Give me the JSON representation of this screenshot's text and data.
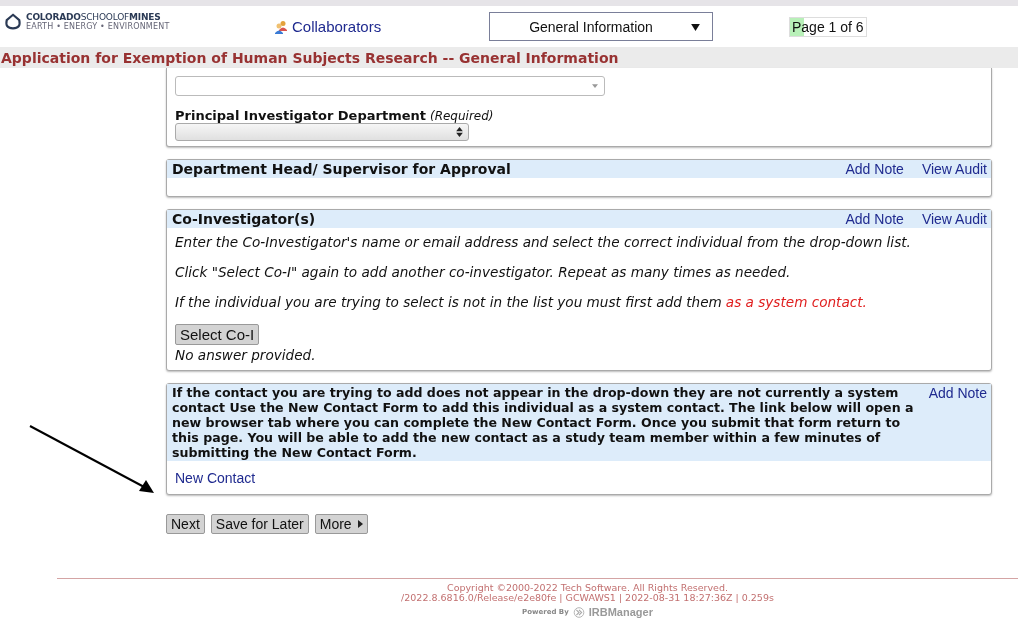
{
  "header": {
    "logo": {
      "wordmark": "**COLORADO**SCHOOLOF**MINES**",
      "tagline": "EARTH • ENERGY • ENVIRONMENT"
    },
    "collaborators": "Collaborators",
    "section_select": "General Information",
    "page_indicator": "Page 1 of 6"
  },
  "page_title": "Application for Exemption of Human Subjects Research -- General Information",
  "sections": [
    {
      "kind": "fields",
      "fields": [
        {
          "kind": "wide_select"
        },
        {
          "kind": "select",
          "label": "Principal Investigator Department",
          "hint": "(Required)"
        }
      ]
    },
    {
      "kind": "question",
      "title": "Department Head/ Supervisor for Approval",
      "actions": [
        "Add Note",
        "View Audit"
      ]
    },
    {
      "kind": "question",
      "title": "Co-Investigator(s)",
      "actions": [
        "Add Note",
        "View Audit"
      ],
      "paragraphs": [
        {
          "text": "Enter the Co-Investigator's name or email address and select the correct individual from the drop-down list."
        },
        {
          "text": "Click \"Select Co-I\" again to add another co-investigator. Repeat as many times as needed."
        },
        {
          "text": "If the individual you are trying to select is not in the list you must first add them",
          "link": "as a system contact."
        }
      ],
      "button": "Select Co-I",
      "answer": "No answer provided."
    },
    {
      "kind": "notice",
      "title": "If the contact you are trying to add does not appear in the drop-down they are not currently a system contact Use the New Contact Form to add this individual as a system contact. The link below will open a new browser tab where you can complete the New Contact Form. Once you submit that form return to this page. You will be able to add the new contact as a study team member within a few minutes of submitting the New Contact Form.",
      "actions": [
        "Add Note"
      ],
      "link": "New Contact"
    }
  ],
  "buttons": [
    "Next",
    "Save for Later",
    "More"
  ],
  "footer": {
    "copyright": "Copyright ©2000-2022 Tech Software. All Rights Reserved.",
    "build": "/2022.8.6816.0/Release/e2e80fe | GCWAWS1 | 2022-08-31 18:27:36Z | 0.259s",
    "powered_by": "Powered By",
    "brand": "IRBManager"
  }
}
